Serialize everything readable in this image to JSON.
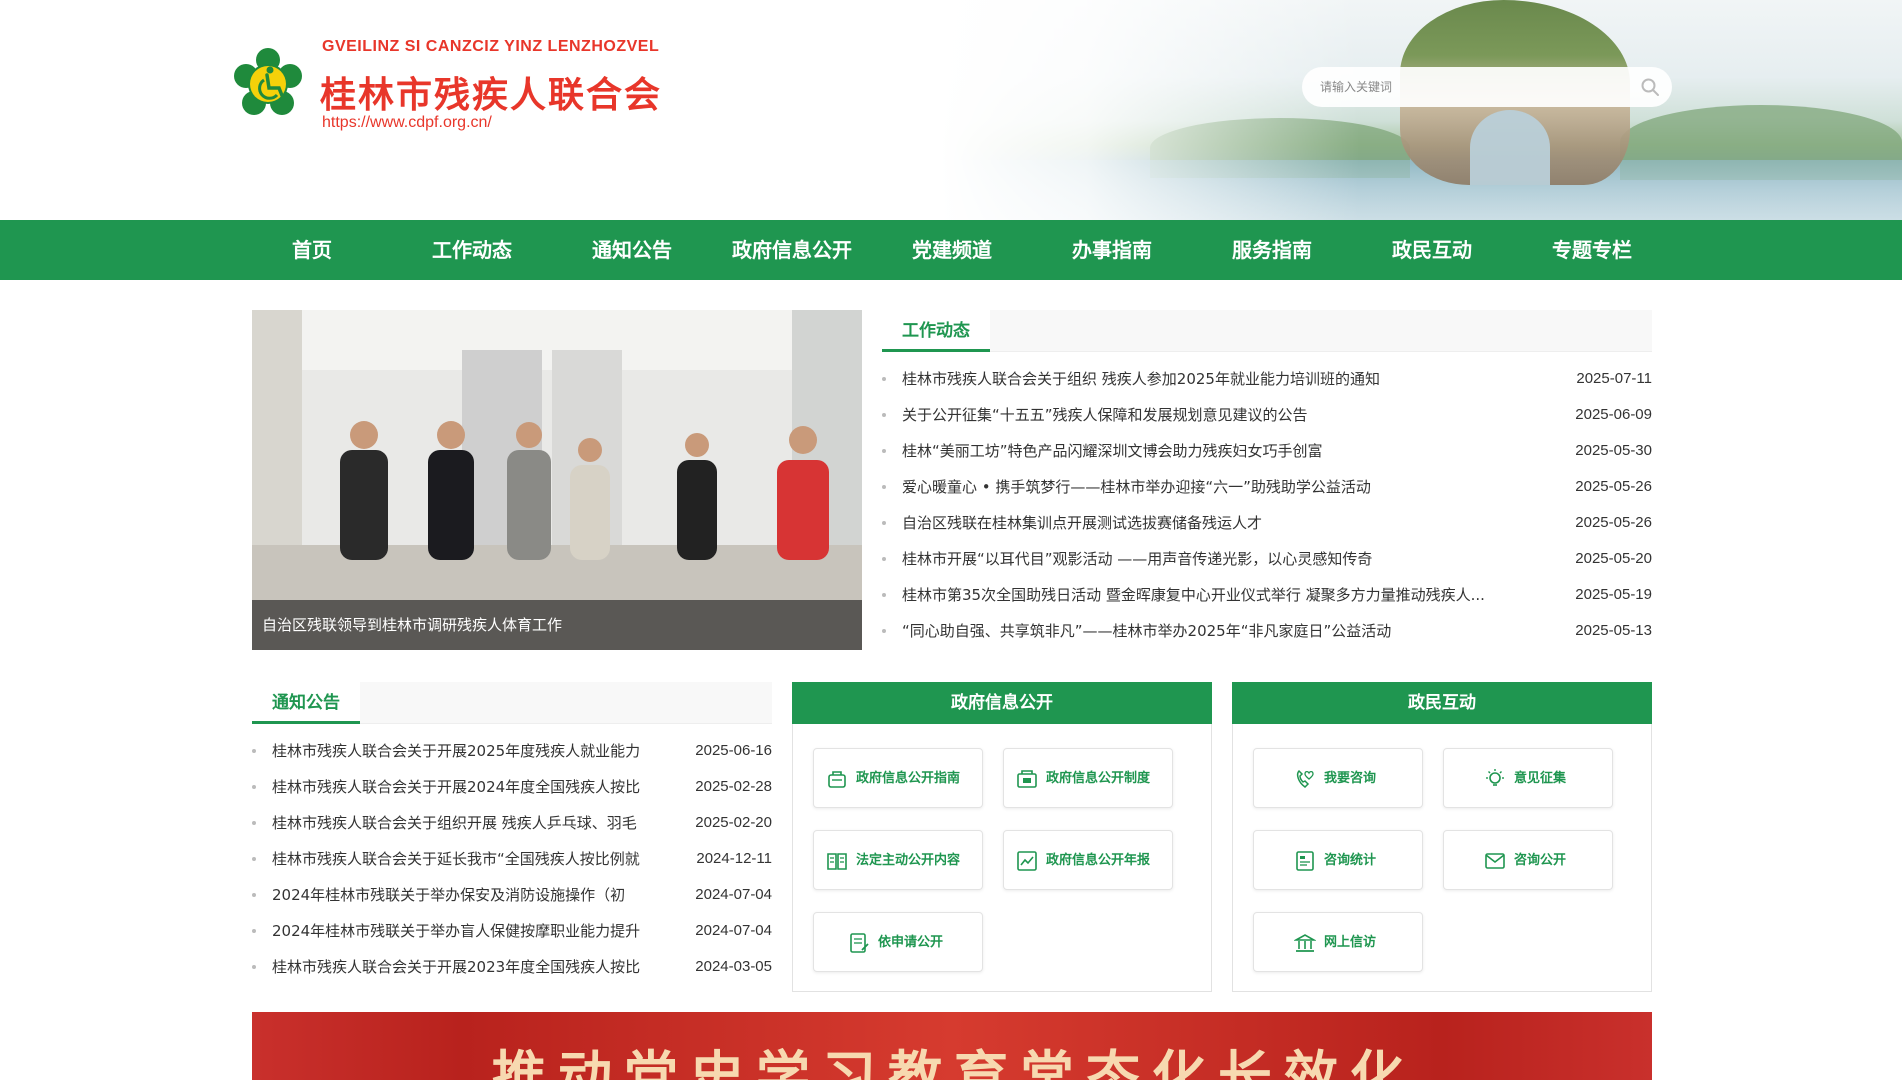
{
  "header": {
    "org_en": "GVEILINZ SI CANZCIZ YINZ LENZHOZVEL",
    "org_cn": "桂林市残疾人联合会",
    "url": "https://www.cdpf.org.cn/",
    "search_placeholder": "请输入关键词"
  },
  "colors": {
    "brand_green": "#1f9650",
    "brand_red": "#e8362a",
    "accent_blue": "#1e7fd8"
  },
  "nav": {
    "items": [
      {
        "label": "首页"
      },
      {
        "label": "工作动态"
      },
      {
        "label": "通知公告"
      },
      {
        "label": "政府信息公开"
      },
      {
        "label": "党建频道"
      },
      {
        "label": "办事指南"
      },
      {
        "label": "服务指南"
      },
      {
        "label": "政民互动"
      },
      {
        "label": "专题专栏"
      }
    ]
  },
  "slider": {
    "caption": "自治区残联领导到桂林市调研残疾人体育工作",
    "dots_count": 5,
    "active_dot": 5
  },
  "work_news": {
    "tab": "工作动态",
    "items": [
      {
        "title": "桂林市残疾人联合会关于组织 残疾人参加2025年就业能力培训班的通知",
        "date": "2025-07-11"
      },
      {
        "title": "关于公开征集“十五五”残疾人保障和发展规划意见建议的公告",
        "date": "2025-06-09"
      },
      {
        "title": "桂林“美丽工坊”特色产品闪耀深圳文博会助力残疾妇女巧手创富",
        "date": "2025-05-30"
      },
      {
        "title": "爱心暖童心 • 携手筑梦行——桂林市举办迎接“六一”助残助学公益活动",
        "date": "2025-05-26"
      },
      {
        "title": "自治区残联在桂林集训点开展测试选拔赛储备残运人才",
        "date": "2025-05-26"
      },
      {
        "title": "桂林市开展“以耳代目”观影活动 ——用声音传递光影，以心灵感知传奇",
        "date": "2025-05-20"
      },
      {
        "title": "桂林市第35次全国助残日活动 暨金晖康复中心开业仪式举行 凝聚多方力量推动残疾人...",
        "date": "2025-05-19"
      },
      {
        "title": "“同心助自强、共享筑非凡”——桂林市举办2025年“非凡家庭日”公益活动",
        "date": "2025-05-13"
      }
    ]
  },
  "notices": {
    "tab": "通知公告",
    "items": [
      {
        "title": "桂林市残疾人联合会关于开展2025年度残疾人就业能力",
        "date": "2025-06-16"
      },
      {
        "title": "桂林市残疾人联合会关于开展2024年度全国残疾人按比",
        "date": "2025-02-28"
      },
      {
        "title": "桂林市残疾人联合会关于组织开展 残疾人乒乓球、羽毛",
        "date": "2025-02-20"
      },
      {
        "title": "桂林市残疾人联合会关于延长我市“全国残疾人按比例就",
        "date": "2024-12-11"
      },
      {
        "title": "2024年桂林市残联关于举办保安及消防设施操作（初",
        "date": "2024-07-04"
      },
      {
        "title": "2024年桂林市残联关于举办盲人保健按摩职业能力提升",
        "date": "2024-07-04"
      },
      {
        "title": "桂林市残疾人联合会关于开展2023年度全国残疾人按比",
        "date": "2024-03-05"
      }
    ]
  },
  "gov_info": {
    "title": "政府信息公开",
    "buttons": [
      {
        "label": "政府信息公开指南",
        "icon": "guide-icon"
      },
      {
        "label": "政府信息公开制度",
        "icon": "policy-icon"
      },
      {
        "label": "法定主动公开内容",
        "icon": "book-icon"
      },
      {
        "label": "政府信息公开年报",
        "icon": "report-icon"
      },
      {
        "label": "依申请公开",
        "icon": "form-icon"
      }
    ]
  },
  "interaction": {
    "title": "政民互动",
    "buttons": [
      {
        "label": "我要咨询",
        "icon": "phone-heart-icon"
      },
      {
        "label": "意见征集",
        "icon": "lightbulb-icon"
      },
      {
        "label": "咨询统计",
        "icon": "stats-icon"
      },
      {
        "label": "咨询公开",
        "icon": "mail-icon"
      },
      {
        "label": "网上信访",
        "icon": "building-icon"
      }
    ]
  },
  "banner": {
    "text": "推动党史学习教育常态化长效化"
  }
}
